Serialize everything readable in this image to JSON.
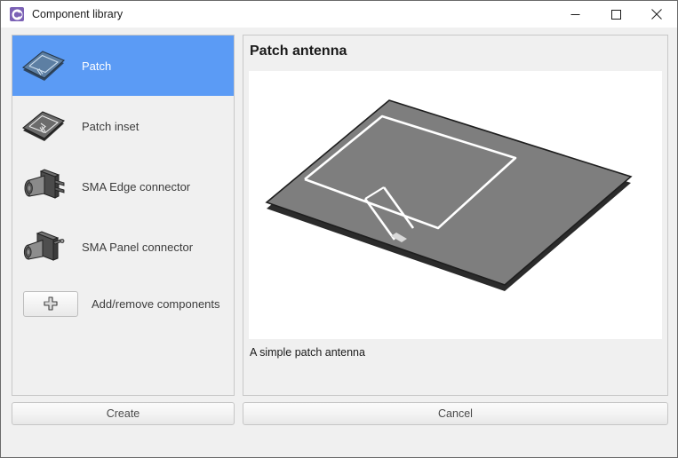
{
  "window": {
    "title": "Component library",
    "app_icon": "library-circle-c-icon",
    "accent_color": "#7b61b5",
    "selection_color": "#5b9bf5",
    "controls": [
      {
        "name": "minimize",
        "glyph": "minimize-icon"
      },
      {
        "name": "maximize",
        "glyph": "maximize-icon"
      },
      {
        "name": "close",
        "glyph": "close-icon"
      }
    ]
  },
  "library": {
    "items": [
      {
        "label": "Patch",
        "icon": "patch-antenna-thumbnail",
        "selected": true
      },
      {
        "label": "Patch inset",
        "icon": "patch-inset-antenna-thumbnail",
        "selected": false
      },
      {
        "label": "SMA Edge connector",
        "icon": "sma-edge-connector-thumbnail",
        "selected": false
      },
      {
        "label": "SMA Panel connector",
        "icon": "sma-panel-connector-thumbnail",
        "selected": false
      }
    ],
    "add_remove": {
      "button_icon": "plus-icon",
      "label": "Add/remove components"
    }
  },
  "detail": {
    "title": "Patch antenna",
    "preview_icon": "patch-antenna-3d-preview",
    "description": "A simple patch antenna"
  },
  "footer": {
    "create_label": "Create",
    "cancel_label": "Cancel"
  }
}
